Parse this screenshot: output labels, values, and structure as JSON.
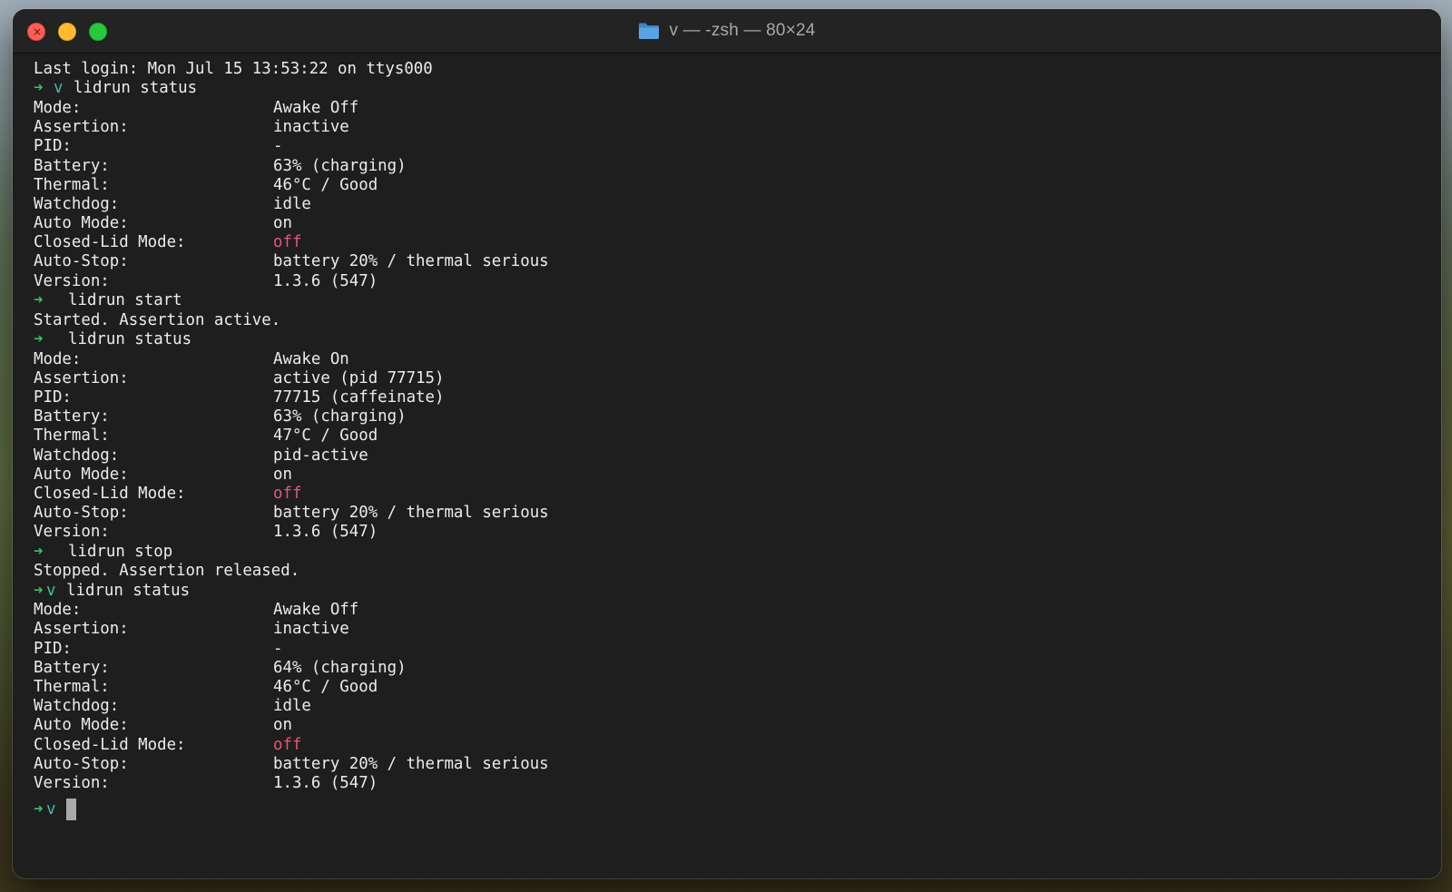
{
  "window": {
    "title": "v — -zsh — 80×24",
    "buttons": {
      "close_glyph": "×"
    },
    "folder_icon": "folder-icon",
    "colors": {
      "background": "#1e1e1e",
      "prompt_arrow": "#39c35b",
      "prompt_dir": "#3fbfa8",
      "off_value": "#e2587a",
      "text": "#ececec"
    }
  },
  "terminal": {
    "last_login": "Last login: Mon Jul 15 13:53:22 on ttys000",
    "prompt_arrow": "➜",
    "prompt_dir": "v",
    "sessions": [
      {
        "command": "lidrun status",
        "rows": [
          {
            "label": "Mode:",
            "value": "Awake Off"
          },
          {
            "label": "Assertion:",
            "value": "inactive"
          },
          {
            "label": "PID:",
            "value": "-"
          },
          {
            "label": "Battery:",
            "value": "63% (charging)"
          },
          {
            "label": "Thermal:",
            "value": "46°C / Good"
          },
          {
            "label": "Watchdog:",
            "value": "idle"
          },
          {
            "label": "Auto Mode:",
            "value": "on"
          },
          {
            "label": "Closed-Lid Mode:",
            "value": "off"
          },
          {
            "label": "Auto-Stop:",
            "value": "battery 20% / thermal serious"
          },
          {
            "label": "Version:",
            "value": "1.3.6 (547)"
          }
        ]
      },
      {
        "command": "lidrun start",
        "output": "Started. Assertion active."
      },
      {
        "command": "lidrun status",
        "rows": [
          {
            "label": "Mode:",
            "value": "Awake On"
          },
          {
            "label": "Assertion:",
            "value": "active (pid 77715)"
          },
          {
            "label": "PID:",
            "value": "77715 (caffeinate)"
          },
          {
            "label": "Battery:",
            "value": "63% (charging)"
          },
          {
            "label": "Thermal:",
            "value": "47°C / Good"
          },
          {
            "label": "Watchdog:",
            "value": "pid-active"
          },
          {
            "label": "Auto Mode:",
            "value": "on"
          },
          {
            "label": "Closed-Lid Mode:",
            "value": "off"
          },
          {
            "label": "Auto-Stop:",
            "value": "battery 20% / thermal serious"
          },
          {
            "label": "Version:",
            "value": "1.3.6 (547)"
          }
        ]
      },
      {
        "command": "lidrun stop",
        "output": "Stopped. Assertion released."
      },
      {
        "command": "lidrun status",
        "rows": [
          {
            "label": "Mode:",
            "value": "Awake Off"
          },
          {
            "label": "Assertion:",
            "value": "inactive"
          },
          {
            "label": "PID:",
            "value": "-"
          },
          {
            "label": "Battery:",
            "value": "64% (charging)"
          },
          {
            "label": "Thermal:",
            "value": "46°C / Good"
          },
          {
            "label": "Watchdog:",
            "value": "idle"
          },
          {
            "label": "Auto Mode:",
            "value": "on"
          },
          {
            "label": "Closed-Lid Mode:",
            "value": "off"
          },
          {
            "label": "Auto-Stop:",
            "value": "battery 20% / thermal serious"
          },
          {
            "label": "Version:",
            "value": "1.3.6 (547)"
          }
        ]
      }
    ]
  }
}
